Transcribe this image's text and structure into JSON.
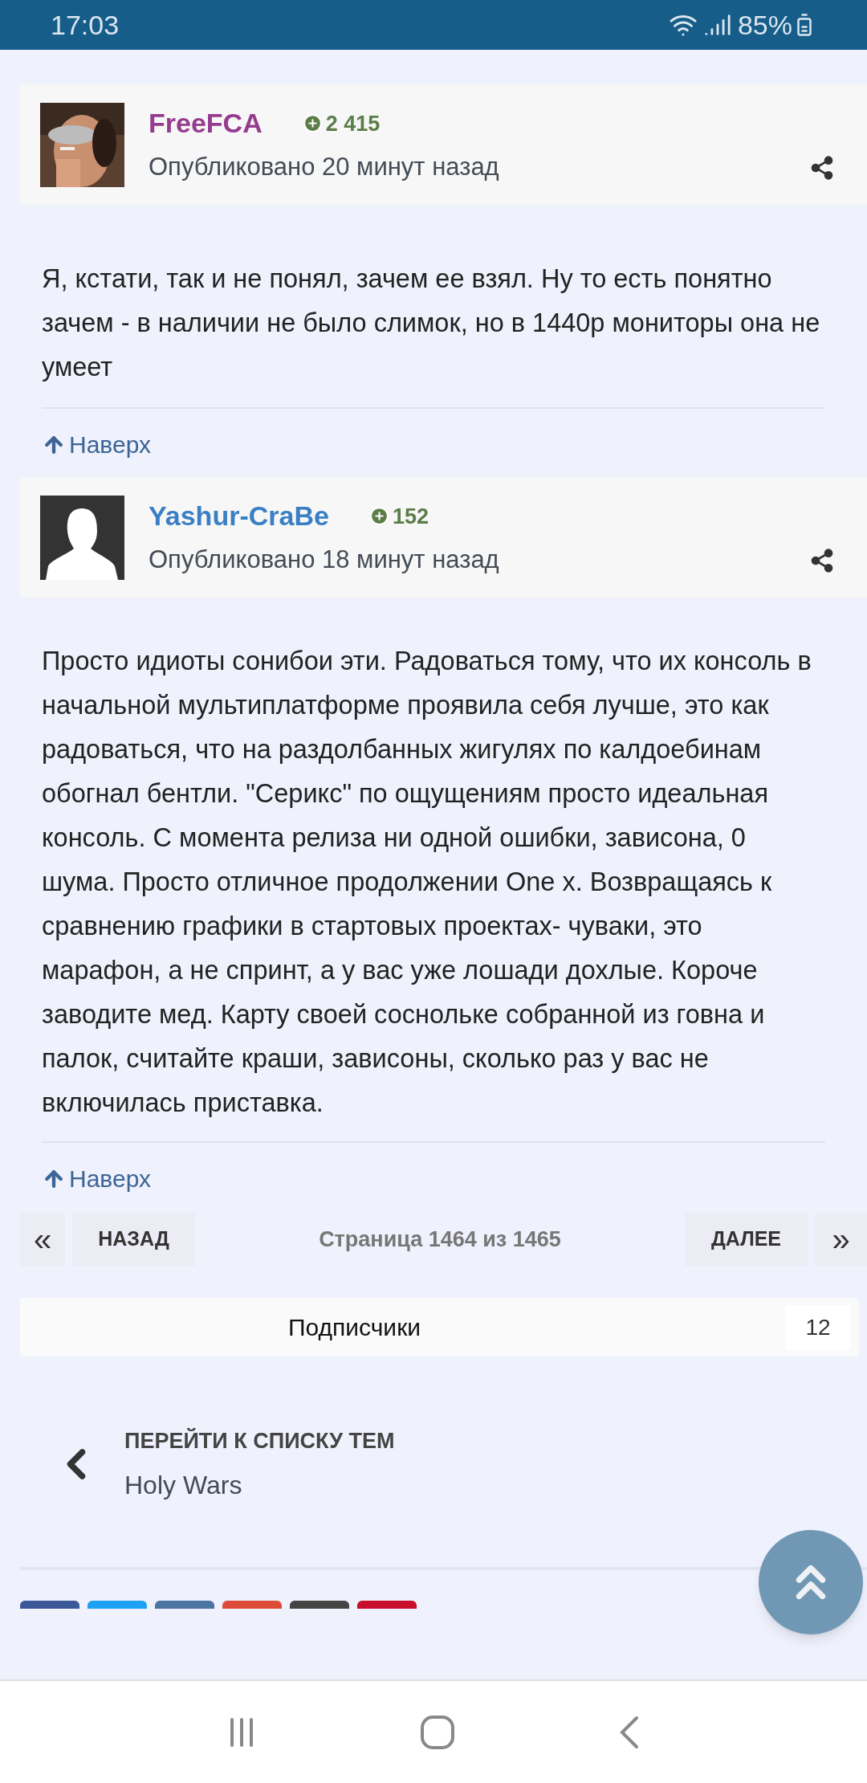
{
  "status_bar": {
    "time": "17:03",
    "battery": "85%"
  },
  "posts": [
    {
      "author": "FreeFCA",
      "color": "#953c8f",
      "reputation": "2 415",
      "posted": "Опубликовано 20 минут назад",
      "body": "Я, кстати, так и не понял, зачем ее взял. Ну то есть понятно зачем - в наличии не было слимок, но в 1440p мониторы она не умеет",
      "top_link": "Наверх"
    },
    {
      "author": "Yashur-CraBe",
      "color": "#3a7fc4",
      "kind": "silhouette",
      "reputation": "152",
      "posted": "Опубликовано 18 минут назад",
      "body": "Просто идиоты сонибои эти. Радоваться тому, что их консоль в начальной мультиплатформе проявила себя лучше, это как радоваться, что на раздолбанных жигулях по калдоебинам обогнал бентли.  \"Серикс\" по ощущениям просто идеальная консоль. С момента релиза ни одной ошибки, зависона, 0 шума. Просто отличное продолжении One x. Возвращаясь к сравнению графики в стартовых проектах- чуваки, это марафон, а не спринт, а у вас уже лошади дохлые. Короче заводите мед. Карту своей соснольке собранной из говна и палок, считайте краши, зависоны, сколько раз у вас не включилась приставка.",
      "top_link": "Наверх"
    }
  ],
  "pagination": {
    "first": "«",
    "prev": "НАЗАД",
    "page_info": "Страница 1464 из 1465",
    "next": "ДАЛЕЕ",
    "last": "»"
  },
  "followers": {
    "label": "Подписчики",
    "count": "12"
  },
  "back_link": {
    "label": "ПЕРЕЙТИ К СПИСКУ ТЕМ",
    "forum": "Holy Wars"
  },
  "share_buttons": [
    {
      "color": "#3b5998"
    },
    {
      "color": "#1da1f2"
    },
    {
      "color": "#4c75a3"
    },
    {
      "color": "#dd4b39"
    },
    {
      "color": "#444444"
    },
    {
      "color": "#c8102e"
    }
  ]
}
